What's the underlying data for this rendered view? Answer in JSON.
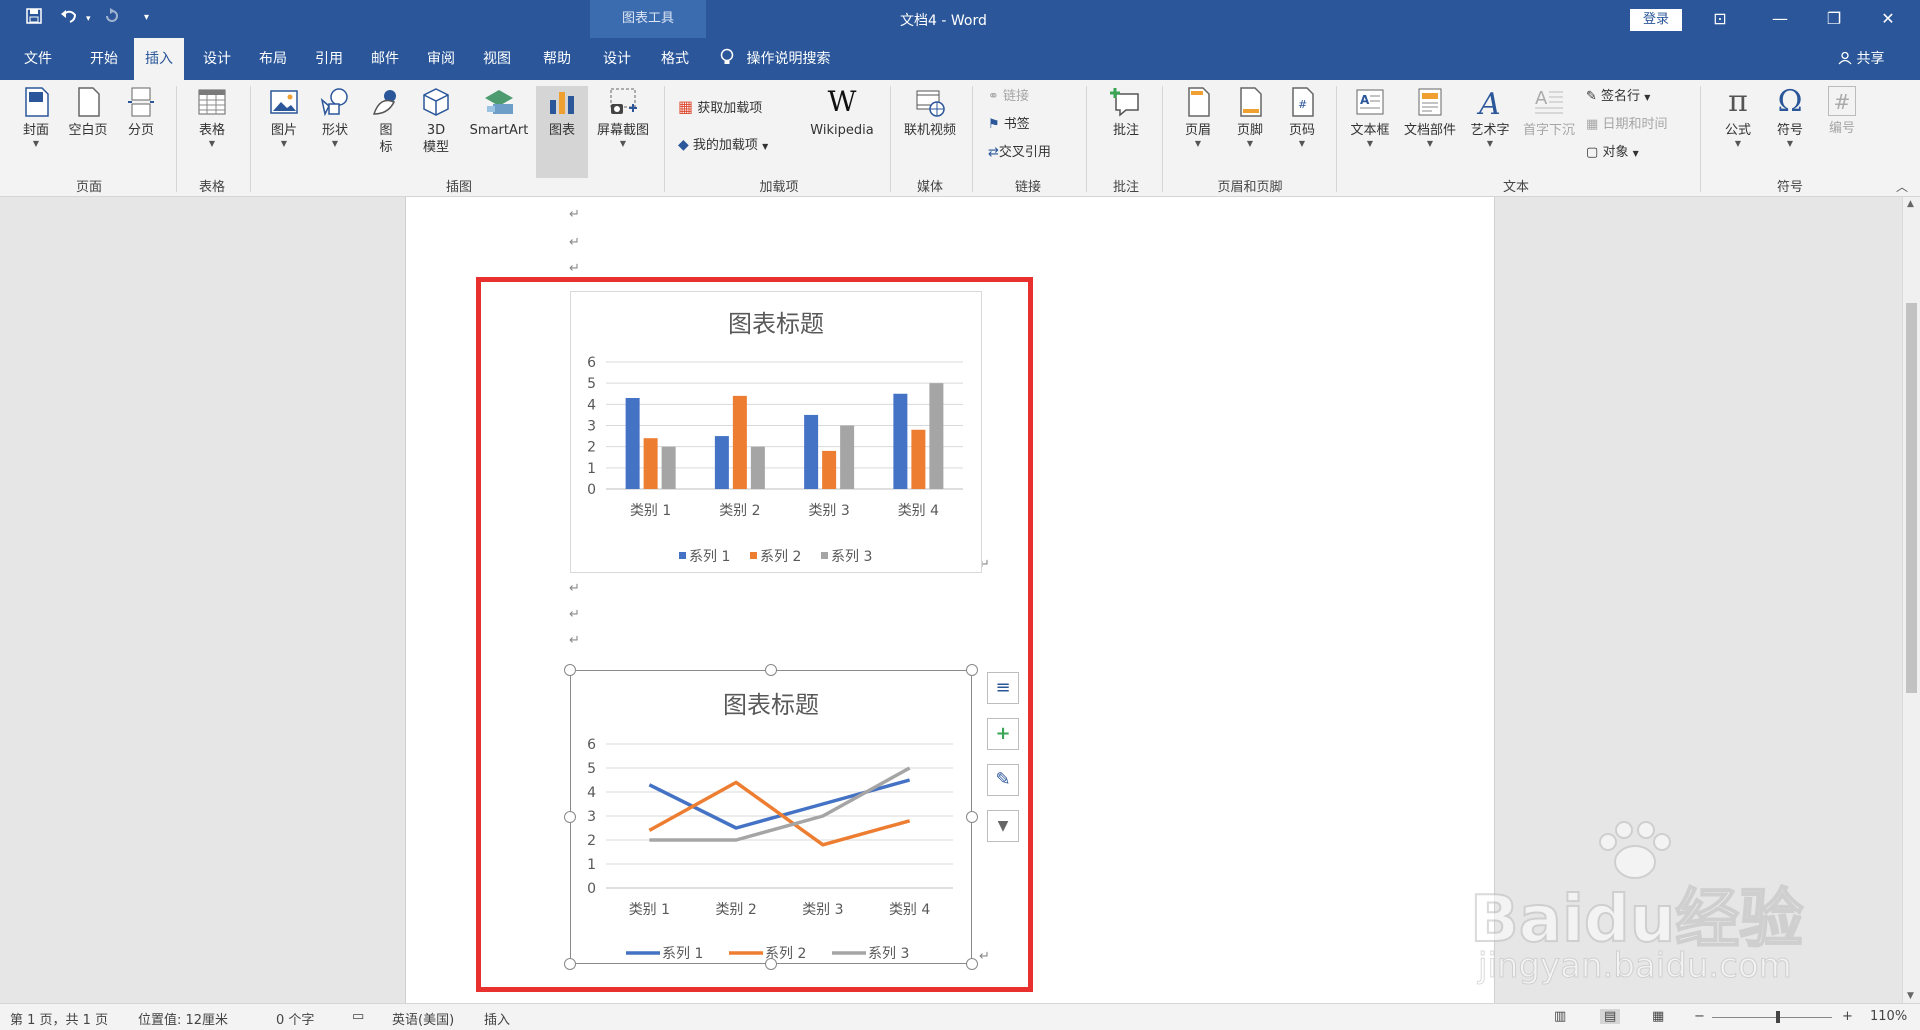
{
  "window": {
    "title": "文档4 - Word",
    "context_tab": "图表工具",
    "login": "登录",
    "minimize_glyph": "—",
    "restore_glyph": "❐",
    "close_glyph": "✕",
    "ribbon_display_glyph": "⊡"
  },
  "quick_access": {
    "save_icon": "save-icon",
    "undo_icon": "undo-icon",
    "redo_icon": "redo-icon",
    "customize_icon": "customize-icon"
  },
  "tabs": [
    {
      "label": "文件"
    },
    {
      "label": "开始"
    },
    {
      "label": "插入",
      "active": true
    },
    {
      "label": "设计"
    },
    {
      "label": "布局"
    },
    {
      "label": "引用"
    },
    {
      "label": "邮件"
    },
    {
      "label": "审阅"
    },
    {
      "label": "视图"
    },
    {
      "label": "帮助"
    },
    {
      "label": "设计"
    },
    {
      "label": "格式"
    }
  ],
  "tell_me": "操作说明搜索",
  "share": "共享",
  "ribbon": {
    "groups": {
      "pages": "页面",
      "tables": "表格",
      "illustrations": "插图",
      "addins": "加载项",
      "media": "媒体",
      "links": "链接",
      "comments": "批注",
      "header_footer": "页眉和页脚",
      "text": "文本",
      "symbols": "符号"
    },
    "buttons": {
      "cover": "封面",
      "blank_page": "空白页",
      "page_break": "分页",
      "table": "表格",
      "pictures": "图片",
      "shapes": "形状",
      "icons_1": "图",
      "icons_2": "标",
      "model_1": "3D",
      "model_2": "模型",
      "smartart": "SmartArt",
      "chart": "图表",
      "screenshot": "屏幕截图",
      "get_addins": "获取加载项",
      "my_addins": "我的加载项",
      "wikipedia": "Wikipedia",
      "wikipedia_glyph": "W",
      "online_video": "联机视频",
      "link": "链接",
      "bookmark": "书签",
      "cross_ref": "交叉引用",
      "comment": "批注",
      "header": "页眉",
      "footer": "页脚",
      "page_number": "页码",
      "textbox": "文本框",
      "quick_parts": "文档部件",
      "wordart": "艺术字",
      "dropcap": "首字下沉",
      "signature_line": "签名行",
      "date_time": "日期和时间",
      "object": "对象",
      "equation": "公式",
      "symbol": "符号",
      "numbering": "编号",
      "equation_glyph": "π",
      "symbol_glyph": "Ω",
      "numbering_glyph": "#"
    }
  },
  "document": {
    "para_mark": "↵"
  },
  "chart1": {
    "title": "图表标题"
  },
  "chart2": {
    "title": "图表标题"
  },
  "chart_data": [
    {
      "type": "bar",
      "title": "图表标题",
      "categories": [
        "类别 1",
        "类别 2",
        "类别 3",
        "类别 4"
      ],
      "series": [
        {
          "name": "系列 1",
          "values": [
            4.3,
            2.5,
            3.5,
            4.5
          ],
          "color": "#4472c4"
        },
        {
          "name": "系列 2",
          "values": [
            2.4,
            4.4,
            1.8,
            2.8
          ],
          "color": "#ed7d31"
        },
        {
          "name": "系列 3",
          "values": [
            2,
            2,
            3,
            5
          ],
          "color": "#a5a5a5"
        }
      ],
      "yticks": [
        "0",
        "1",
        "2",
        "3",
        "4",
        "5",
        "6"
      ],
      "ylim": [
        0,
        6
      ],
      "grid": true,
      "legend": "bottom"
    },
    {
      "type": "line",
      "title": "图表标题",
      "categories": [
        "类别 1",
        "类别 2",
        "类别 3",
        "类别 4"
      ],
      "series": [
        {
          "name": "系列 1",
          "values": [
            4.3,
            2.5,
            3.5,
            4.5
          ],
          "color": "#4472c4"
        },
        {
          "name": "系列 2",
          "values": [
            2.4,
            4.4,
            1.8,
            2.8
          ],
          "color": "#ed7d31"
        },
        {
          "name": "系列 3",
          "values": [
            2,
            2,
            3,
            5
          ],
          "color": "#a5a5a5"
        }
      ],
      "yticks": [
        "0",
        "1",
        "2",
        "3",
        "4",
        "5",
        "6"
      ],
      "ylim": [
        0,
        6
      ],
      "grid": true,
      "legend": "bottom"
    }
  ],
  "chart_side_buttons": [
    {
      "name": "layout-options-icon",
      "glyph": "≡"
    },
    {
      "name": "chart-elements-icon",
      "glyph": "+"
    },
    {
      "name": "chart-styles-icon",
      "glyph": "✎"
    },
    {
      "name": "chart-filters-icon",
      "glyph": "▼"
    }
  ],
  "status": {
    "page": "第 1 页，共 1 页",
    "position": "位置值: 12厘米",
    "words": "0 个字",
    "language": "英语(美国)",
    "mode": "插入",
    "zoom": "110%",
    "zoom_minus": "−",
    "zoom_plus": "+",
    "zoom_level": 0.55
  },
  "watermark": {
    "main": "Baidu经验",
    "url": "jingyan.baidu.com"
  }
}
